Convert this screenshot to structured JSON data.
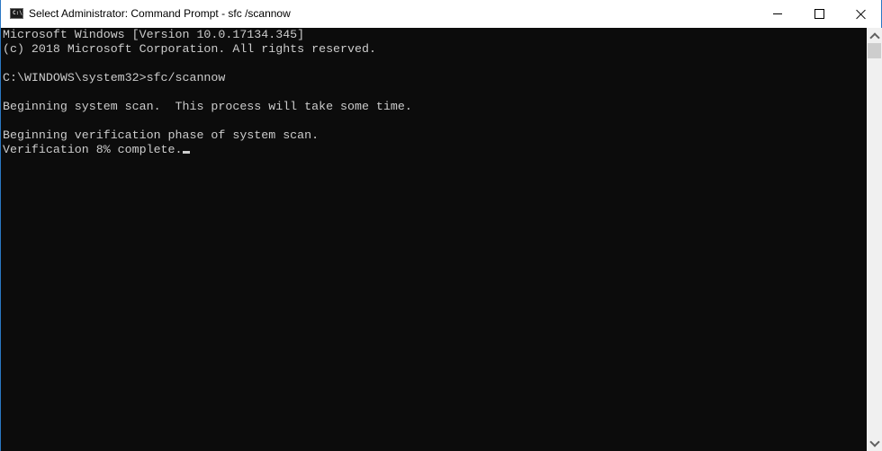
{
  "window": {
    "title": "Select Administrator: Command Prompt - sfc /scannow",
    "app_icon": "cmd-icon",
    "app_icon_text": "C:\\.",
    "controls": {
      "minimize": "minimize-icon",
      "maximize": "maximize-icon",
      "close": "close-icon"
    }
  },
  "console": {
    "lines": [
      "Microsoft Windows [Version 10.0.17134.345]",
      "(c) 2018 Microsoft Corporation. All rights reserved.",
      "",
      "C:\\WINDOWS\\system32>sfc/scannow",
      "",
      "Beginning system scan.  This process will take some time.",
      "",
      "Beginning verification phase of system scan.",
      "Verification 8% complete."
    ],
    "verification_progress_percent": 8,
    "colors": {
      "background": "#0c0c0c",
      "foreground": "#cccccc"
    }
  },
  "scrollbar": {
    "up_icon": "chevron-up-icon",
    "down_icon": "chevron-down-icon"
  }
}
